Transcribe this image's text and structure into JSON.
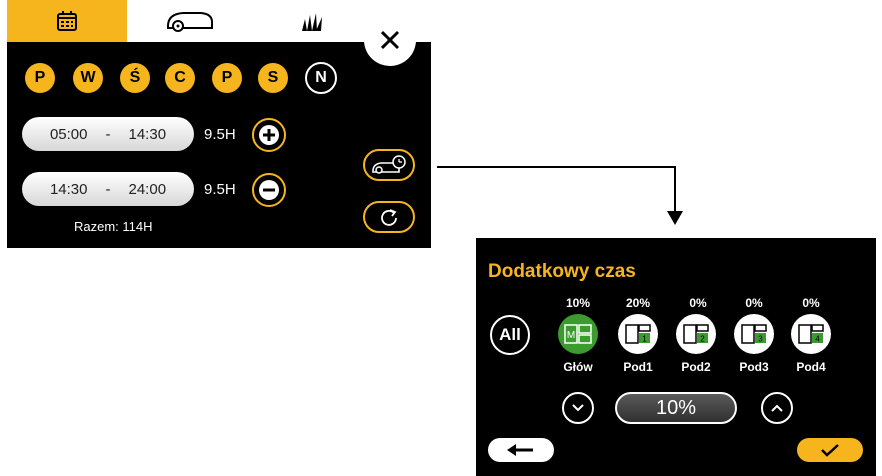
{
  "tabs": [
    {
      "icon": "calendar-icon",
      "active": true
    },
    {
      "icon": "robot-mower-icon",
      "active": false
    },
    {
      "icon": "grass-icon",
      "active": false
    }
  ],
  "schedule": {
    "days": [
      {
        "label": "P",
        "active": true
      },
      {
        "label": "W",
        "active": true
      },
      {
        "label": "Ś",
        "active": true
      },
      {
        "label": "C",
        "active": true
      },
      {
        "label": "P",
        "active": true
      },
      {
        "label": "S",
        "active": true
      },
      {
        "label": "N",
        "active": false
      }
    ],
    "slots": [
      {
        "start": "05:00",
        "sep": "-",
        "end": "14:30",
        "hours": "9.5H"
      },
      {
        "start": "14:30",
        "sep": "-",
        "end": "24:00",
        "hours": "9.5H"
      }
    ],
    "total": "Razem: 114H"
  },
  "extra_time": {
    "title": "Dodatkowy czas",
    "all_label": "All",
    "zones": [
      {
        "label": "Głów",
        "percent": "10%",
        "icon_text": "M",
        "selected": true
      },
      {
        "label": "Pod1",
        "percent": "20%",
        "icon_text": "1",
        "selected": false
      },
      {
        "label": "Pod2",
        "percent": "0%",
        "icon_text": "2",
        "selected": false
      },
      {
        "label": "Pod3",
        "percent": "0%",
        "icon_text": "3",
        "selected": false
      },
      {
        "label": "Pod4",
        "percent": "0%",
        "icon_text": "4",
        "selected": false
      }
    ],
    "value": "10%"
  },
  "colors": {
    "accent": "#f7b51d",
    "panel": "#000000",
    "zone_selected": "#3c9b2f"
  }
}
